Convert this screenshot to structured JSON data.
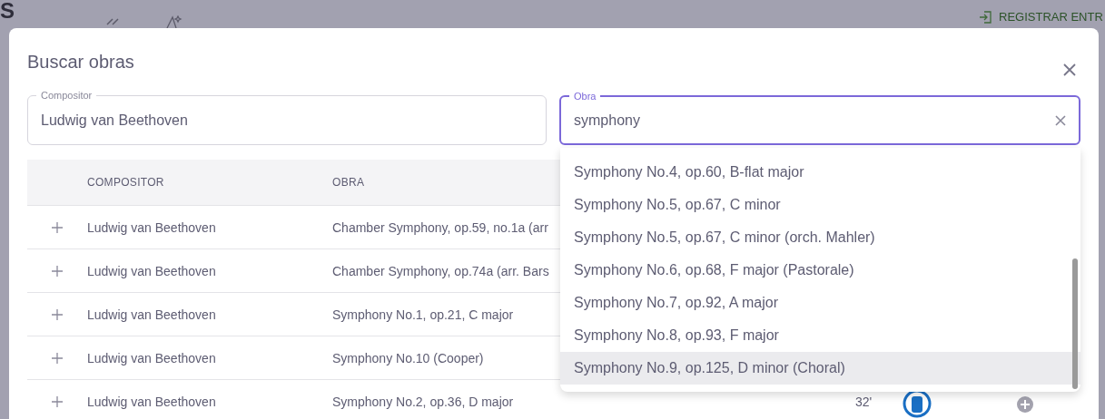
{
  "background": {
    "title": "S",
    "action": "REGISTRAR ENTR"
  },
  "dialog": {
    "title": "Buscar obras",
    "fields": [
      {
        "label": "Compositor",
        "value": "Ludwig van Beethoven",
        "focused": false,
        "clearable": false
      },
      {
        "label": "Obra",
        "value": "symphony",
        "focused": true,
        "clearable": true
      }
    ],
    "table": {
      "columns": [
        "COMPOSITOR",
        "OBRA"
      ],
      "rows": [
        {
          "composer": "Ludwig van Beethoven",
          "work": "Chamber Symphony, op.59, no.1a (arr"
        },
        {
          "composer": "Ludwig van Beethoven",
          "work": "Chamber Symphony, op.74a (arr. Bars"
        },
        {
          "composer": "Ludwig van Beethoven",
          "work": "Symphony No.1, op.21, C major"
        },
        {
          "composer": "Ludwig van Beethoven",
          "work": "Symphony No.10 (Cooper)"
        },
        {
          "composer": "Ludwig van Beethoven",
          "work": "Symphony No.2, op.36, D major",
          "duration": "32'"
        }
      ]
    },
    "dropdown": {
      "options": [
        {
          "label": "Symphony No.4, op.60, B-flat major",
          "selected": false
        },
        {
          "label": "Symphony No.5, op.67, C minor",
          "selected": false
        },
        {
          "label": "Symphony No.5, op.67, C minor (orch. Mahler)",
          "selected": false
        },
        {
          "label": "Symphony No.6, op.68, F major (Pastorale)",
          "selected": false
        },
        {
          "label": "Symphony No.7, op.92, A major",
          "selected": false
        },
        {
          "label": "Symphony No.8, op.93, F major",
          "selected": false
        },
        {
          "label": "Symphony No.9, op.125, D minor (Choral)",
          "selected": true
        }
      ]
    }
  }
}
